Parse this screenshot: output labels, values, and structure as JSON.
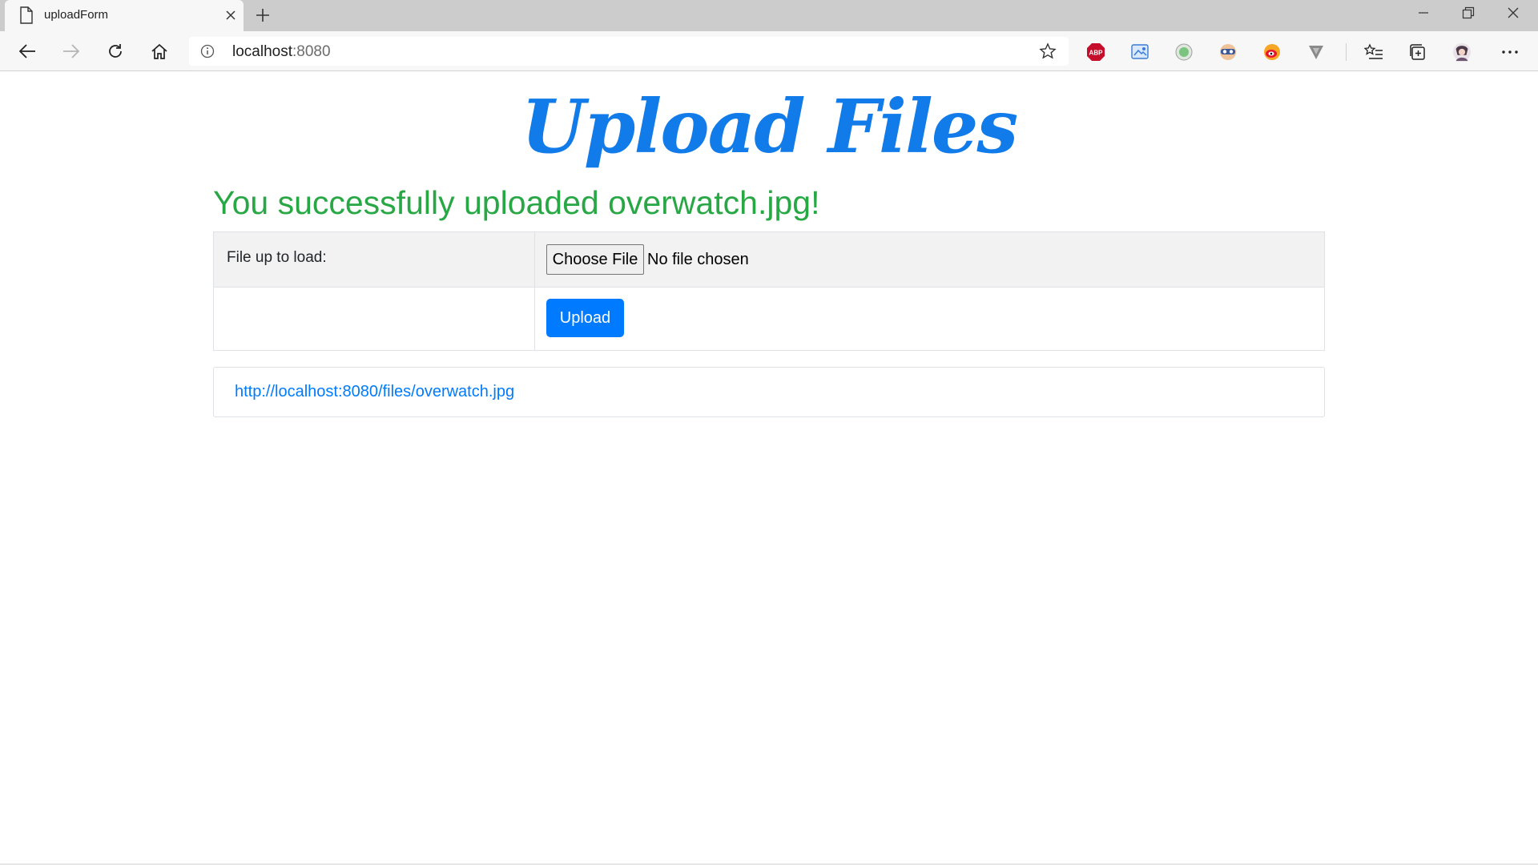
{
  "browser": {
    "tab_title": "uploadForm",
    "url_host": "localhost",
    "url_port": ":8080"
  },
  "extensions": [
    {
      "name": "adblock-plus",
      "label": "ABP",
      "color": "#c70d2c"
    },
    {
      "name": "screenshot-extension",
      "color": "#3a7bd5"
    },
    {
      "name": "green-circle-extension",
      "color": "#7bc47f"
    },
    {
      "name": "mask-extension",
      "color": "#3b5998"
    },
    {
      "name": "weibo-extension",
      "color": "#e6162d"
    },
    {
      "name": "v-extension",
      "color": "#8a8a8a"
    }
  ],
  "page": {
    "title": "Upload Files",
    "success_message": "You successfully uploaded overwatch.jpg!",
    "form": {
      "file_label": "File up to load:",
      "choose_file_label": "Choose File",
      "no_file_text": "No file chosen",
      "upload_label": "Upload"
    },
    "uploaded_link": "http://localhost:8080/files/overwatch.jpg"
  },
  "colors": {
    "title_blue": "#117bea",
    "success_green": "#28a745",
    "primary_button": "#007bff"
  }
}
